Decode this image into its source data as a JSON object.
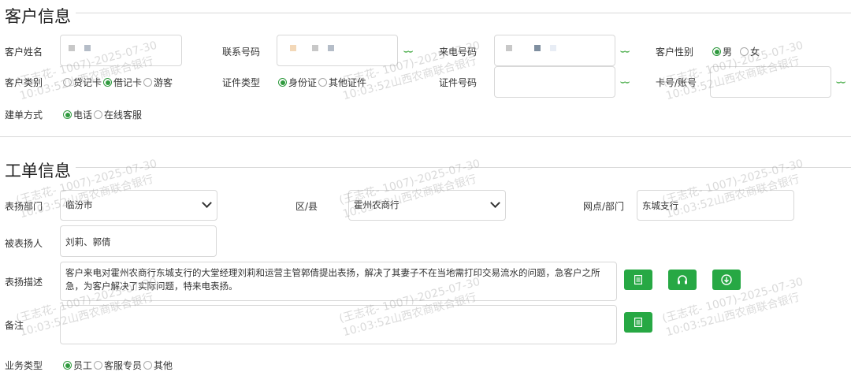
{
  "customer": {
    "title": "客户信息",
    "name_label": "客户姓名",
    "phone_label": "联系号码",
    "incoming_label": "来电号码",
    "gender_label": "客户性别",
    "gender_options": [
      "男",
      "女"
    ],
    "category_label": "客户类别",
    "category_options": [
      "贷记卡",
      "借记卡",
      "游客"
    ],
    "id_type_label": "证件类型",
    "id_type_options": [
      "身份证",
      "其他证件"
    ],
    "id_number_label": "证件号码",
    "card_label": "卡号/账号",
    "create_label": "建单方式",
    "create_options": [
      "电话",
      "在线客服"
    ]
  },
  "order": {
    "title": "工单信息",
    "dept_label": "表扬部门",
    "dept_value": "临汾市",
    "county_label": "区/县",
    "county_value": "霍州农商行",
    "branch_label": "网点/部门",
    "branch_value": "东城支行",
    "praised_label": "被表扬人",
    "praised_value": "刘莉、郭倩",
    "desc_label": "表扬描述",
    "desc_value": "客户来电对霍州农商行东城支行的大堂经理刘莉和运营主管郭倩提出表扬，解决了其妻子不在当地需打印交易流水的问题，急客户之所急，为客户解决了实际问题，特来电表扬。",
    "remark_label": "备注",
    "biz_label": "业务类型",
    "biz_options": [
      "员工",
      "客服专员",
      "其他"
    ]
  },
  "watermark": {
    "line1": "(王志花- 1007)-2025-07-30",
    "line2": "10:03:52山西农商联合银行"
  },
  "colors": {
    "accent": "#27a844",
    "eye": "#4cae4c"
  }
}
